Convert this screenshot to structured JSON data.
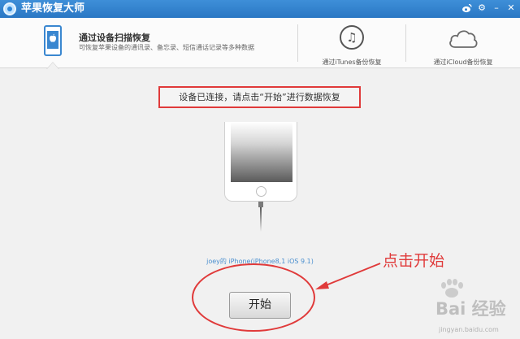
{
  "window": {
    "title": "苹果恢复大师",
    "controls": {
      "weibo": "weibo-icon",
      "settings": "⚙",
      "minimize": "–",
      "close": "✕"
    }
  },
  "tabs": [
    {
      "title": "通过设备扫描恢复",
      "description": "可恢复苹果设备的通讯录、备忘录、短信通话记录等多种数据",
      "icon": "iphone-icon",
      "selected": true
    },
    {
      "label": "通过iTunes备份恢复",
      "icon": "music-note-icon",
      "glyph": "♫"
    },
    {
      "label": "通过iCloud备份恢复",
      "icon": "cloud-icon"
    }
  ],
  "main": {
    "notice": "设备已连接，请点击“开始”进行数据恢复",
    "device_label": "joey的 iPhone(iPhone8,1 iOS 9.1)",
    "start_button": "开始"
  },
  "annotation": {
    "text": "点击开始",
    "color": "#e03a3a"
  },
  "watermark": {
    "logo": "Bai 经验",
    "url": "jingyan.baidu.com"
  },
  "colors": {
    "titlebar": "#2f80cc",
    "accent": "#3a87d0",
    "annotation": "#e03a3a"
  }
}
